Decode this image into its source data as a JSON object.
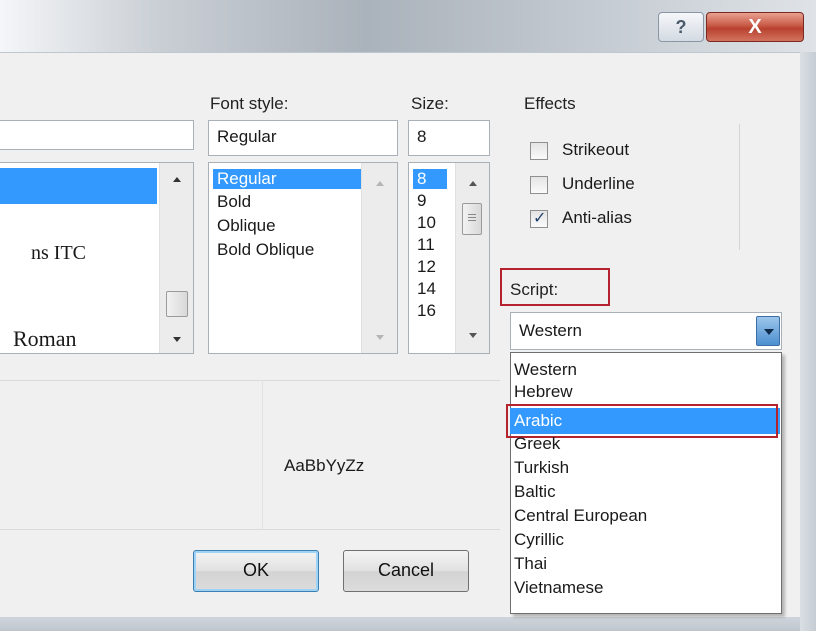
{
  "titlebar": {
    "help_glyph": "?",
    "close_glyph": "X"
  },
  "font_list": {
    "items": [
      "",
      "ns ITC",
      "Roman"
    ]
  },
  "font_style": {
    "label": "Font style:",
    "value": "Regular",
    "items": [
      "Regular",
      "Bold",
      "Oblique",
      "Bold Oblique"
    ]
  },
  "size": {
    "label": "Size:",
    "value": "8",
    "items": [
      "8",
      "9",
      "10",
      "11",
      "12",
      "14",
      "16"
    ]
  },
  "effects": {
    "label": "Effects",
    "strikeout": {
      "label": "Strikeout",
      "checked": false
    },
    "underline": {
      "label": "Underline",
      "checked": false
    },
    "antialias": {
      "label": "Anti-alias",
      "checked": true
    }
  },
  "script": {
    "label": "Script:",
    "value": "Western",
    "options": [
      "Western",
      "Hebrew",
      "Arabic",
      "Greek",
      "Turkish",
      "Baltic",
      "Central European",
      "Cyrillic",
      "Thai",
      "Vietnamese"
    ],
    "highlighted": "Arabic"
  },
  "sample": {
    "text": "AaBbYyZz"
  },
  "buttons": {
    "ok": "OK",
    "cancel": "Cancel"
  },
  "colors": {
    "selection": "#3399ff",
    "highlight_box": "#b5232f",
    "close_button": "#c75a46"
  }
}
